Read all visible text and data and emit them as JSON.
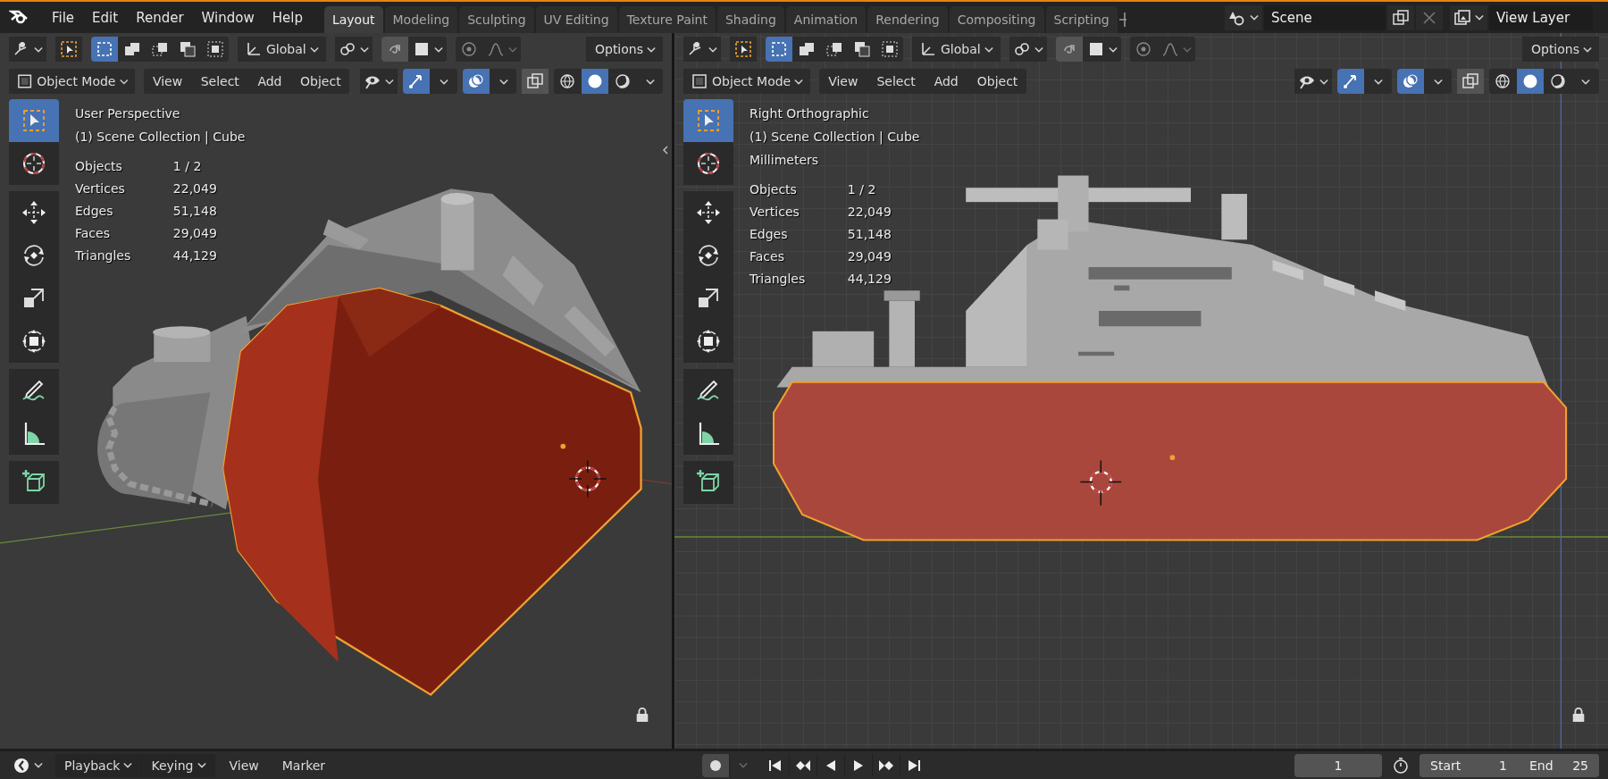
{
  "top_bar": {
    "menus": [
      "File",
      "Edit",
      "Render",
      "Window",
      "Help"
    ],
    "workspaces": [
      {
        "label": "Layout",
        "selected": true
      },
      {
        "label": "Modeling",
        "selected": false
      },
      {
        "label": "Sculpting",
        "selected": false
      },
      {
        "label": "UV Editing",
        "selected": false
      },
      {
        "label": "Texture Paint",
        "selected": false
      },
      {
        "label": "Shading",
        "selected": false
      },
      {
        "label": "Animation",
        "selected": false
      },
      {
        "label": "Rendering",
        "selected": false
      },
      {
        "label": "Compositing",
        "selected": false
      },
      {
        "label": "Scripting",
        "selected": false
      }
    ],
    "scene": "Scene",
    "view_layer": "View Layer"
  },
  "viewports": [
    {
      "kind": "perspective",
      "orientation": "Global",
      "options": "Options",
      "mode": "Object Mode",
      "menus": [
        "View",
        "Select",
        "Add",
        "Object"
      ],
      "tools": [
        {
          "kind": "select",
          "selected": true
        },
        {
          "kind": "cursor",
          "selected": false
        },
        {
          "kind": "move",
          "selected": false
        },
        {
          "kind": "rotate",
          "selected": false
        },
        {
          "kind": "scale",
          "selected": false
        },
        {
          "kind": "transform",
          "selected": false
        },
        {
          "kind": "annotate",
          "selected": false
        },
        {
          "kind": "measure",
          "selected": false
        },
        {
          "kind": "add-cube",
          "selected": false
        }
      ],
      "title": "User Perspective",
      "collection": "(1) Scene Collection | Cube",
      "stats": [
        {
          "label": "Objects",
          "value": "1 / 2"
        },
        {
          "label": "Vertices",
          "value": "22,049"
        },
        {
          "label": "Edges",
          "value": "51,148"
        },
        {
          "label": "Faces",
          "value": "29,049"
        },
        {
          "label": "Triangles",
          "value": "44,129"
        }
      ]
    },
    {
      "kind": "orthographic",
      "orientation": "Global",
      "options": "Options",
      "mode": "Object Mode",
      "menus": [
        "View",
        "Select",
        "Add",
        "Object"
      ],
      "tools": [
        {
          "kind": "select",
          "selected": true
        },
        {
          "kind": "cursor",
          "selected": false
        },
        {
          "kind": "move",
          "selected": false
        },
        {
          "kind": "rotate",
          "selected": false
        },
        {
          "kind": "scale",
          "selected": false
        },
        {
          "kind": "transform",
          "selected": false
        },
        {
          "kind": "annotate",
          "selected": false
        },
        {
          "kind": "measure",
          "selected": false
        },
        {
          "kind": "add-cube",
          "selected": false
        }
      ],
      "title": "Right Orthographic",
      "collection": "(1) Scene Collection | Cube",
      "units": "Millimeters",
      "stats": [
        {
          "label": "Objects",
          "value": "1 / 2"
        },
        {
          "label": "Vertices",
          "value": "22,049"
        },
        {
          "label": "Edges",
          "value": "51,148"
        },
        {
          "label": "Faces",
          "value": "29,049"
        },
        {
          "label": "Triangles",
          "value": "44,129"
        }
      ]
    }
  ],
  "timeline": {
    "menus": [
      {
        "label": "Playback",
        "dropdown": true
      },
      {
        "label": "Keying",
        "dropdown": true
      },
      {
        "label": "View",
        "dropdown": false
      },
      {
        "label": "Marker",
        "dropdown": false
      }
    ],
    "current_frame": "1",
    "start_label": "Start",
    "start": "1",
    "end_label": "End",
    "end": "25"
  }
}
